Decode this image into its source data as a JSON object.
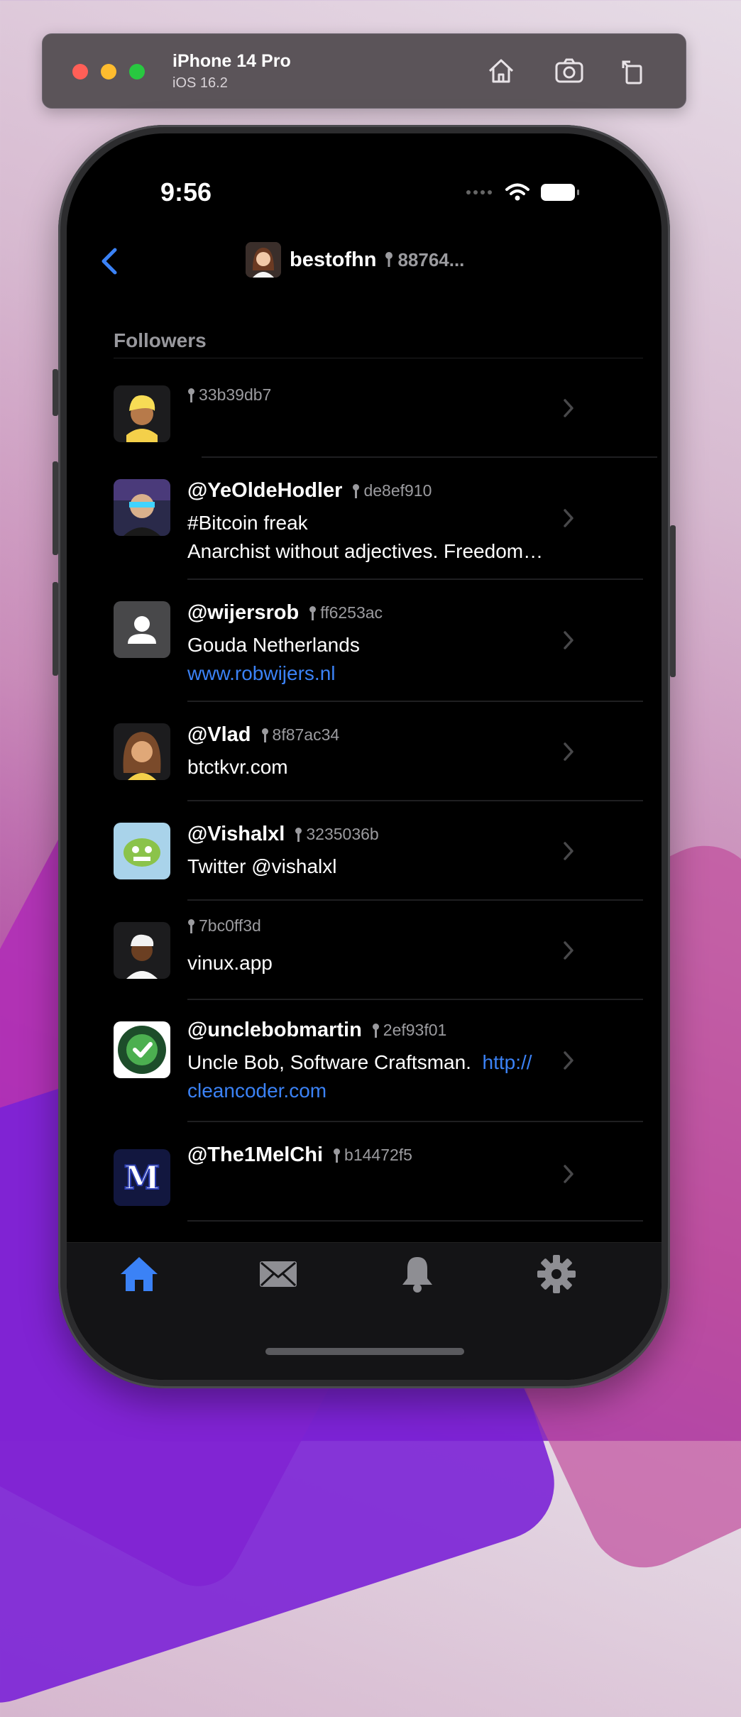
{
  "simulator": {
    "device": "iPhone 14 Pro",
    "os": "iOS 16.2",
    "buttons": [
      "home-icon",
      "screenshot-icon",
      "rotate-icon"
    ]
  },
  "status_bar": {
    "time": "9:56"
  },
  "nav": {
    "title": "bestofhn",
    "key": "88764..."
  },
  "section": {
    "header": "Followers"
  },
  "followers": [
    {
      "name": "",
      "key": "33b39db7",
      "about": "",
      "link": ""
    },
    {
      "name": "@YeOldeHodler",
      "key": "de8ef910",
      "about": "#Bitcoin freak\nAnarchist without adjectives. Freedom…",
      "link": ""
    },
    {
      "name": "@wijersrob",
      "key": "ff6253ac",
      "about": "Gouda Netherlands",
      "link": "www.robwijers.nl"
    },
    {
      "name": "@Vlad",
      "key": "8f87ac34",
      "about": "btctkvr.com",
      "link": ""
    },
    {
      "name": "@Vishalxl",
      "key": "3235036b",
      "about": "Twitter @vishalxl",
      "link": ""
    },
    {
      "name": "",
      "key": "7bc0ff3d",
      "about": "vinux.app",
      "link": ""
    },
    {
      "name": "@unclebobmartin",
      "key": "2ef93f01",
      "about": "Uncle Bob, Software Craftsman.  ",
      "link": "http://\ncleancoder.com"
    },
    {
      "name": "@The1MelChi",
      "key": "b14472f5",
      "about": "",
      "link": ""
    }
  ],
  "tabs": [
    {
      "name": "home",
      "active": true
    },
    {
      "name": "messages",
      "active": false
    },
    {
      "name": "notifications",
      "active": false
    },
    {
      "name": "settings",
      "active": false
    }
  ],
  "colors": {
    "accent": "#3b82f6",
    "background": "#000000",
    "secondary_text": "#9b9b9f"
  }
}
